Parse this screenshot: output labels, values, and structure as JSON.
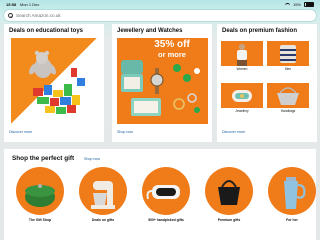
{
  "status_bar": {
    "time": "15:58",
    "date": "Mon 1 Dec",
    "battery": "15%"
  },
  "search": {
    "placeholder": "Search Amazon.co.uk"
  },
  "cards": {
    "toys": {
      "title": "Deals on educational toys",
      "link": "Discover more"
    },
    "jewellery": {
      "title": "Jewellery and Watches",
      "promo_line1": "35% off",
      "promo_line2": "or more",
      "link": "Shop now"
    },
    "fashion": {
      "title": "Deals on premium fashion",
      "tiles": [
        {
          "label": "Women"
        },
        {
          "label": "Men"
        },
        {
          "label": "Jewellery"
        },
        {
          "label": "Handbags"
        }
      ],
      "link": "Discover more"
    }
  },
  "gift": {
    "title": "Shop the perfect gift",
    "link": "Shop now",
    "items": [
      {
        "label": "The Gift Shop"
      },
      {
        "label": "Deals on gifts"
      },
      {
        "label": "500+ handpicked gifts"
      },
      {
        "label": "Premium gifts"
      },
      {
        "label": "For her"
      }
    ]
  },
  "colors": {
    "accent_orange": "#f07b19",
    "link_blue": "#2162a1",
    "search_bar_tint": "#b6e6e6"
  }
}
